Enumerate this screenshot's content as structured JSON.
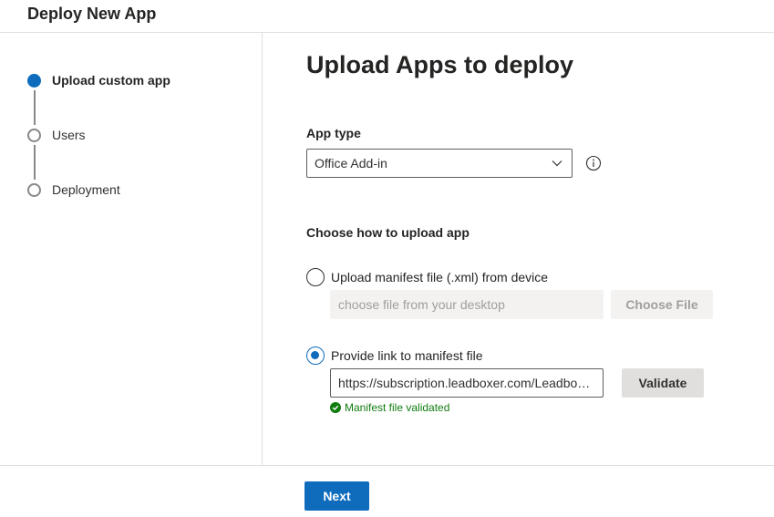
{
  "header": {
    "title": "Deploy New App"
  },
  "steps": [
    {
      "label": "Upload custom app",
      "active": true
    },
    {
      "label": "Users",
      "active": false
    },
    {
      "label": "Deployment",
      "active": false
    }
  ],
  "main": {
    "title": "Upload Apps to deploy",
    "app_type": {
      "label": "App type",
      "selected": "Office Add-in"
    },
    "upload_method": {
      "label": "Choose how to upload app",
      "option_file": {
        "label": "Upload manifest file (.xml) from device",
        "selected": false,
        "placeholder": "choose file from your desktop",
        "button": "Choose File"
      },
      "option_link": {
        "label": "Provide link to manifest file",
        "selected": true,
        "value": "https://subscription.leadboxer.com/LeadboxerOutlookAddIn/manifest.xml",
        "button": "Validate",
        "status": "Manifest file validated"
      }
    }
  },
  "footer": {
    "next_label": "Next"
  },
  "colors": {
    "accent": "#0f6cbd",
    "success": "#107c10",
    "border": "#e1dfdd"
  }
}
